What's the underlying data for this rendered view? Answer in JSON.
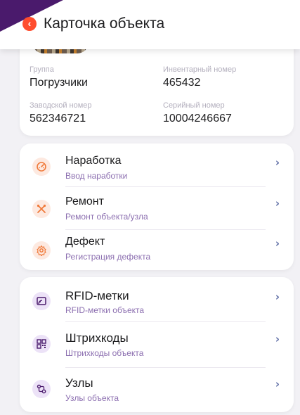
{
  "header": {
    "back_icon": "chevron-left-icon",
    "back_glyph": "‹",
    "title": "Карточка объекта",
    "accent_color": "#4a1a6c",
    "back_color": "#ff4d2e"
  },
  "info": {
    "group_label": "Группа",
    "group_value": "Погрузчики",
    "inventory_label": "Инвентарный номер",
    "inventory_value": "465432",
    "factory_label": "Заводской номер",
    "factory_value": "562346721",
    "serial_label": "Серийный номер",
    "serial_value": "10004246667"
  },
  "actions": [
    {
      "title": "Наработка",
      "subtitle": "Ввод наработки",
      "icon": "gauge-icon"
    },
    {
      "title": "Ремонт",
      "subtitle": "Ремонт объекта/узла",
      "icon": "tools-icon"
    },
    {
      "title": "Дефект",
      "subtitle": "Регистрация дефекта",
      "icon": "gear-icon"
    }
  ],
  "links": [
    {
      "title": "RFID-метки",
      "subtitle": "RFID-метки объекта",
      "icon": "rfid-icon"
    },
    {
      "title": "Штрихкоды",
      "subtitle": "Штрихкоды объекта",
      "icon": "qr-code-icon"
    },
    {
      "title": "Узлы",
      "subtitle": "Узлы объекта",
      "icon": "nodes-icon"
    }
  ],
  "chevron": "›",
  "colors": {
    "action_icon_bg": "#fde9e0",
    "action_icon_fg": "#f07a3a",
    "link_icon_bg": "#ece2f7",
    "link_icon_fg": "#4a1a6c",
    "subtitle": "#8c6fb0"
  }
}
